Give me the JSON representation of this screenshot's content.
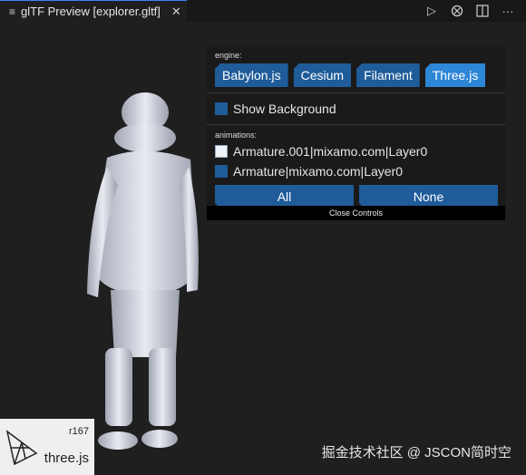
{
  "tab": {
    "title": "glTF Preview [explorer.gltf]",
    "icons": [
      "file-lines-icon",
      "close-icon"
    ]
  },
  "toolbar": {
    "icons": [
      "run-icon",
      "debug-icon",
      "split-editor-icon",
      "more-icon"
    ]
  },
  "controls": {
    "engine_label": "engine:",
    "engines": [
      "Babylon.js",
      "Cesium",
      "Filament",
      "Three.js"
    ],
    "active_engine": "Three.js",
    "show_background": {
      "label": "Show Background",
      "checked": false
    },
    "animations_label": "animations:",
    "animations": [
      {
        "label": "Armature.001|mixamo.com|Layer0",
        "checked": true
      },
      {
        "label": "Armature|mixamo.com|Layer0",
        "checked": false
      }
    ],
    "all_label": "All",
    "none_label": "None",
    "close_label": "Close Controls"
  },
  "badge": {
    "revision": "r167",
    "name": "three.js"
  },
  "watermark": "掘金技术社区 @ JSCON简时空",
  "colors": {
    "button": "#1f5c99",
    "active_button": "#2e86d6",
    "tab_accent": "#3b82f6"
  }
}
